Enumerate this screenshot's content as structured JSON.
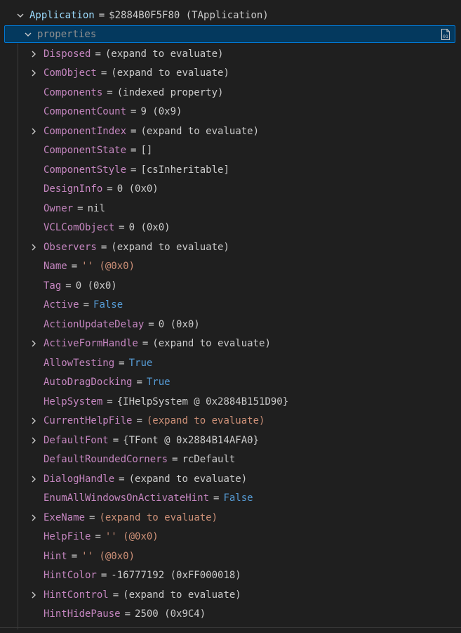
{
  "root": {
    "name": "Application",
    "eq": "=",
    "value": "$2884B0F5F80 (TApplication)"
  },
  "properties": {
    "label": "properties",
    "copy_icon": "binary-01-icon"
  },
  "items": [
    {
      "name": "Disposed",
      "value": "(expand to evaluate)",
      "expandable": true,
      "kind": "plain"
    },
    {
      "name": "ComObject",
      "value": "(expand to evaluate)",
      "expandable": true,
      "kind": "plain"
    },
    {
      "name": "Components",
      "value": "(indexed property)",
      "expandable": false,
      "kind": "plain"
    },
    {
      "name": "ComponentCount",
      "value": "9  (0x9)",
      "expandable": false,
      "kind": "plain"
    },
    {
      "name": "ComponentIndex",
      "value": "(expand to evaluate)",
      "expandable": true,
      "kind": "plain"
    },
    {
      "name": "ComponentState",
      "value": "[]",
      "expandable": false,
      "kind": "plain"
    },
    {
      "name": "ComponentStyle",
      "value": "[csInheritable]",
      "expandable": false,
      "kind": "plain"
    },
    {
      "name": "DesignInfo",
      "value": "0  (0x0)",
      "expandable": false,
      "kind": "plain"
    },
    {
      "name": "Owner",
      "value": "nil",
      "expandable": false,
      "kind": "plain"
    },
    {
      "name": "VCLComObject",
      "value": "0  (0x0)",
      "expandable": false,
      "kind": "plain"
    },
    {
      "name": "Observers",
      "value": "(expand to evaluate)",
      "expandable": true,
      "kind": "plain"
    },
    {
      "name": "Name",
      "value": "''  (@0x0)",
      "expandable": false,
      "kind": "str"
    },
    {
      "name": "Tag",
      "value": "0  (0x0)",
      "expandable": false,
      "kind": "plain"
    },
    {
      "name": "Active",
      "value": "False",
      "expandable": false,
      "kind": "bool"
    },
    {
      "name": "ActionUpdateDelay",
      "value": "0  (0x0)",
      "expandable": false,
      "kind": "plain"
    },
    {
      "name": "ActiveFormHandle",
      "value": "(expand to evaluate)",
      "expandable": true,
      "kind": "plain"
    },
    {
      "name": "AllowTesting",
      "value": "True",
      "expandable": false,
      "kind": "bool"
    },
    {
      "name": "AutoDragDocking",
      "value": "True",
      "expandable": false,
      "kind": "bool"
    },
    {
      "name": "HelpSystem",
      "value": "{IHelpSystem @ 0x2884B151D90}",
      "expandable": false,
      "kind": "plain"
    },
    {
      "name": "CurrentHelpFile",
      "value": "(expand to evaluate)",
      "expandable": true,
      "kind": "str"
    },
    {
      "name": "DefaultFont",
      "value": "{TFont @ 0x2884B14AFA0}",
      "expandable": true,
      "kind": "plain"
    },
    {
      "name": "DefaultRoundedCorners",
      "value": "rcDefault",
      "expandable": false,
      "kind": "plain"
    },
    {
      "name": "DialogHandle",
      "value": "(expand to evaluate)",
      "expandable": true,
      "kind": "plain"
    },
    {
      "name": "EnumAllWindowsOnActivateHint",
      "value": "False",
      "expandable": false,
      "kind": "bool"
    },
    {
      "name": "ExeName",
      "value": "(expand to evaluate)",
      "expandable": true,
      "kind": "str"
    },
    {
      "name": "HelpFile",
      "value": "''  (@0x0)",
      "expandable": false,
      "kind": "str"
    },
    {
      "name": "Hint",
      "value": "''  (@0x0)",
      "expandable": false,
      "kind": "str"
    },
    {
      "name": "HintColor",
      "value": "-16777192  (0xFF000018)",
      "expandable": false,
      "kind": "plain"
    },
    {
      "name": "HintControl",
      "value": "(expand to evaluate)",
      "expandable": true,
      "kind": "plain"
    },
    {
      "name": "HintHidePause",
      "value": "2500  (0x9C4)",
      "expandable": false,
      "kind": "plain"
    }
  ],
  "colors": {
    "background": "#1f1f1f",
    "selection": "#04395e",
    "focus_border": "#0078d4",
    "property_name": "#c586c0",
    "root_name": "#9cdcfe",
    "boolean": "#569cd6",
    "string": "#ce9178"
  }
}
